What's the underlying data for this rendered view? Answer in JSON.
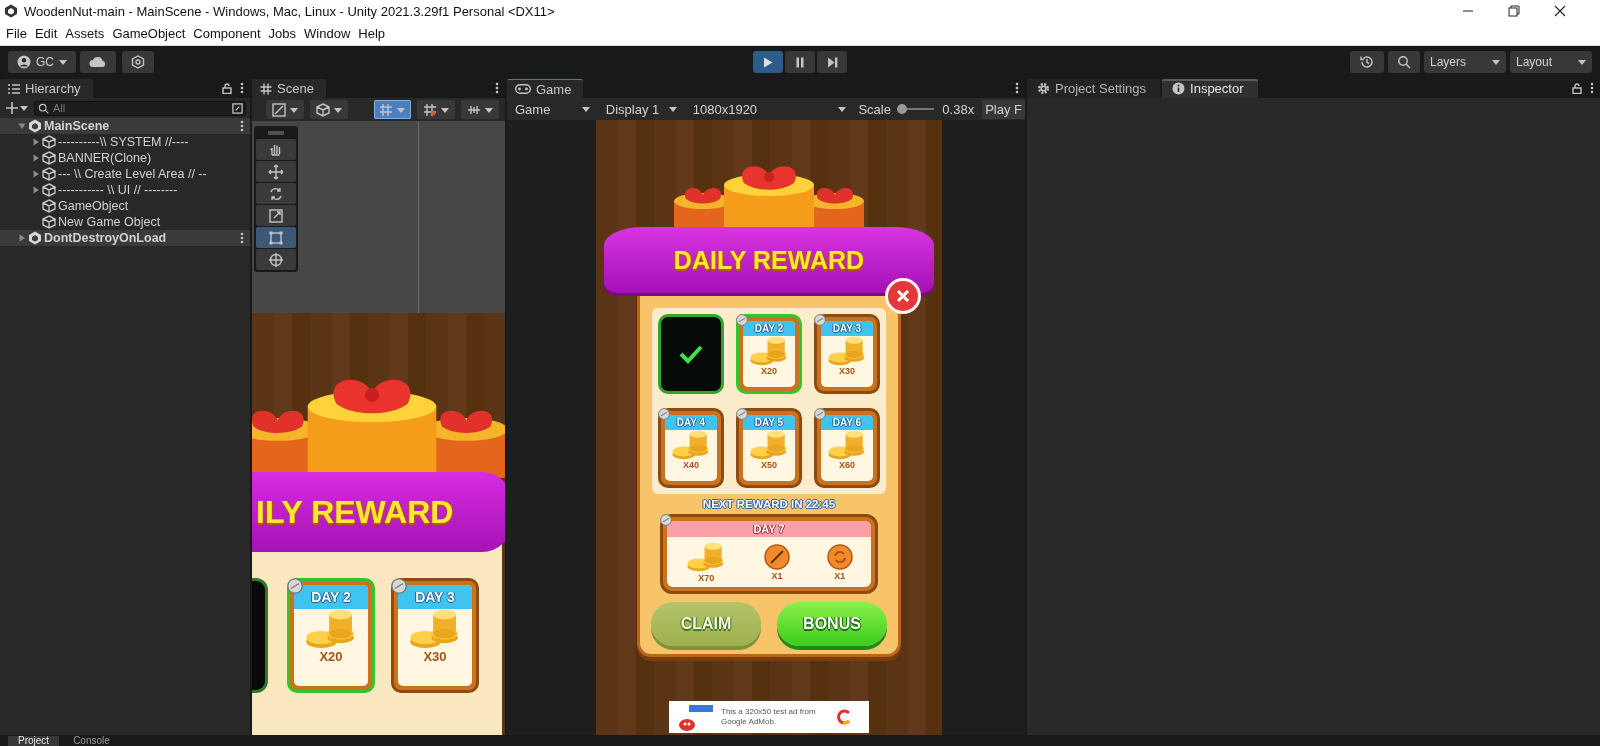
{
  "window": {
    "title": "WoodenNut-main - MainScene - Windows, Mac, Linux - Unity 2021.3.29f1 Personal <DX11>"
  },
  "menu": [
    "File",
    "Edit",
    "Assets",
    "GameObject",
    "Component",
    "Jobs",
    "Window",
    "Help"
  ],
  "toolbar": {
    "account": "GC",
    "playback": [
      {
        "kind": "play",
        "selected": true
      },
      {
        "kind": "pause",
        "selected": false
      },
      {
        "kind": "step",
        "selected": false
      }
    ],
    "layers": "Layers",
    "layout": "Layout"
  },
  "hierarchy": {
    "tab": "Hierarchy",
    "search": {
      "placeholder": "All"
    },
    "items": [
      {
        "label": "MainScene",
        "kind": "scene",
        "expanded": true,
        "children": [
          {
            "label": "----------\\\\ SYSTEM //----",
            "expanded": false
          },
          {
            "label": "BANNER(Clone)",
            "expanded": false
          },
          {
            "label": "--- \\\\ Create Level Area // --",
            "expanded": false
          },
          {
            "label": "----------- \\\\ UI // --------",
            "expanded": false
          },
          {
            "label": "GameObject"
          },
          {
            "label": "New Game Object"
          }
        ]
      },
      {
        "label": "DontDestroyOnLoad",
        "kind": "scene",
        "expanded": false
      }
    ]
  },
  "scene": {
    "tab": "Scene",
    "toolbar": [
      {
        "kind": "draw-mode",
        "selected": false
      },
      {
        "kind": "render-mode",
        "selected": false
      },
      {
        "kind": "grid",
        "selected": true
      },
      {
        "kind": "snap",
        "selected": false
      },
      {
        "kind": "increment",
        "selected": false
      }
    ],
    "tools": [
      {
        "kind": "hand",
        "selected": false
      },
      {
        "kind": "move",
        "selected": false
      },
      {
        "kind": "rotate",
        "selected": false
      },
      {
        "kind": "scale",
        "selected": false
      },
      {
        "kind": "rect",
        "selected": true
      },
      {
        "kind": "transform",
        "selected": false
      }
    ],
    "preview": {
      "title": "ILY REWARD",
      "cards": [
        {
          "label": "DAY 2",
          "amount": "X20",
          "selected": true
        },
        {
          "label": "DAY 3",
          "amount": "X30",
          "selected": false
        }
      ]
    }
  },
  "game": {
    "tab": "Game",
    "mode": "Game",
    "display": "Display 1",
    "resolution": "1080x1920",
    "scale_label": "Scale",
    "scale_slider": {
      "level": 0.1
    },
    "scale": "0.38x",
    "play_mode": "Play F",
    "reward": {
      "title": "DAILY REWARD",
      "days": [
        {
          "kind": "claimed",
          "selected": false
        },
        {
          "kind": "day",
          "label": "DAY 2",
          "amount": "X20",
          "selected": true
        },
        {
          "kind": "day",
          "label": "DAY 3",
          "amount": "X30",
          "selected": false
        },
        {
          "kind": "day",
          "label": "DAY 4",
          "amount": "X40",
          "selected": false
        },
        {
          "kind": "day",
          "label": "DAY 5",
          "amount": "X50",
          "selected": false
        },
        {
          "kind": "day",
          "label": "DAY 6",
          "amount": "X60",
          "selected": false
        }
      ],
      "timer": "NEXT REWARD IN 22:45",
      "final": {
        "label": "DAY 7",
        "items": [
          {
            "kind": "coins",
            "amount": "X70"
          },
          {
            "kind": "hammer",
            "amount": "X1"
          },
          {
            "kind": "refresh",
            "amount": "X1"
          }
        ]
      },
      "buttons": [
        {
          "label": "CLAIM",
          "disabled": true
        },
        {
          "label": "BONUS",
          "disabled": false
        }
      ],
      "ad": {
        "text": "This a 320x50 test ad from Google AdMob."
      }
    }
  },
  "inspector": {
    "tabs": [
      {
        "label": "Project Settings",
        "kind": "settings",
        "selected": false
      },
      {
        "label": "Inspector",
        "kind": "info",
        "selected": true
      }
    ]
  },
  "bottom": {
    "tabs": [
      {
        "label": "Project",
        "selected": true
      },
      {
        "label": "Console",
        "selected": false
      }
    ]
  }
}
